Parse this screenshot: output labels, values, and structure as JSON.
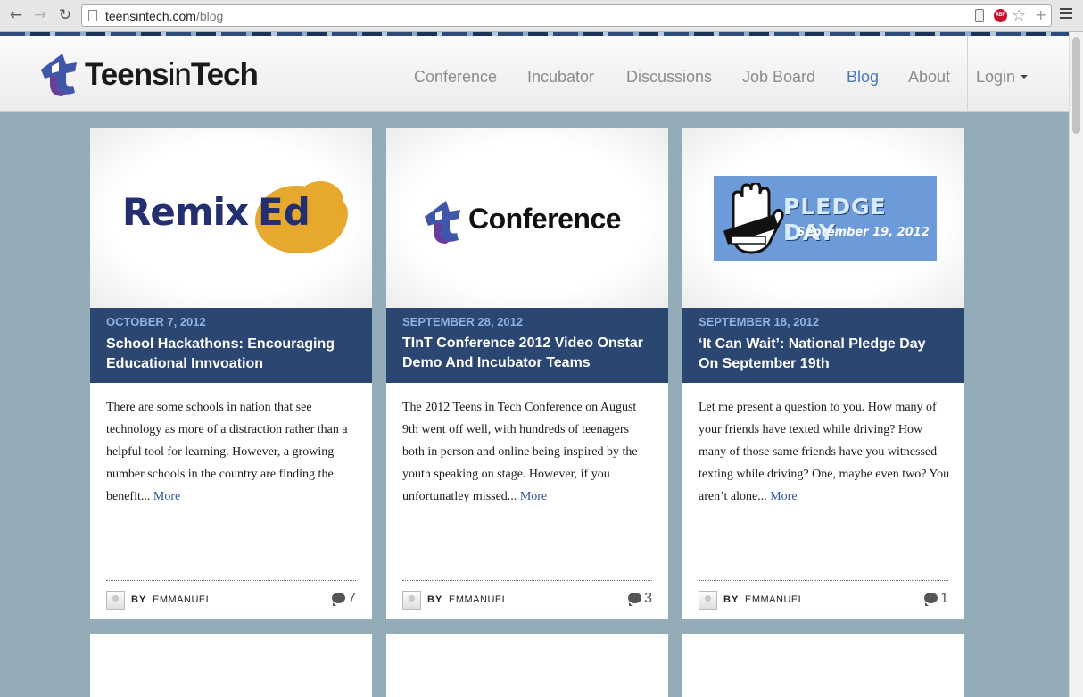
{
  "browser": {
    "url_host": "teensintech.com",
    "url_path": "/blog",
    "back_icon": "←",
    "forward_icon": "→",
    "reload_icon": "↻",
    "abp_label": "ABP",
    "star_icon": "☆",
    "plus_icon": "+"
  },
  "site": {
    "logo_bold": "Teens",
    "logo_in": "in",
    "logo_tech": "Tech",
    "nav": [
      {
        "label": "Conference"
      },
      {
        "label": "Incubator"
      },
      {
        "label": "Discussions"
      },
      {
        "label": "Job Board"
      },
      {
        "label": "Blog"
      },
      {
        "label": "About"
      }
    ],
    "login_label": "Login",
    "active_nav": "Blog",
    "brand_color": "#2b4771",
    "accent_color": "#4a79b3"
  },
  "posts": [
    {
      "image_text_1": "Remix",
      "image_text_2": "Ed",
      "date": "OCTOBER 7, 2012",
      "title": "School Hackathons: Encouraging Educational Innvoation",
      "excerpt": "There are some schools in nation that see technology as more of a distraction rather than a helpful tool for learning. However, a growing number schools in the country are finding the benefit...",
      "more": "More",
      "by": "BY",
      "author": "EMMANUEL",
      "comments": "7"
    },
    {
      "image_text_1": "Conference",
      "date": "SEPTEMBER 28, 2012",
      "title": "TInT Conference 2012 Video Onstar Demo And Incubator Teams",
      "excerpt": "The 2012 Teens in Tech Conference on August 9th went off well, with hundreds of teenagers both in person and online being inspired by the youth speaking on stage. However, if you unfortunatley missed...",
      "more": "More",
      "by": "BY",
      "author": "EMMANUEL",
      "comments": "3"
    },
    {
      "image_text_1": "PLEDGE DAY",
      "image_text_2": "September 19, 2012",
      "date": "SEPTEMBER 18, 2012",
      "title": "‘It Can Wait’: National Pledge Day On September 19th",
      "excerpt": "Let me present a question to you. How many of your friends have texted while driving? How many of those same friends have you witnessed texting while driving? One, maybe even two? You aren’t alone...",
      "more": "More",
      "by": "BY",
      "author": "EMMANUEL",
      "comments": "1"
    }
  ]
}
